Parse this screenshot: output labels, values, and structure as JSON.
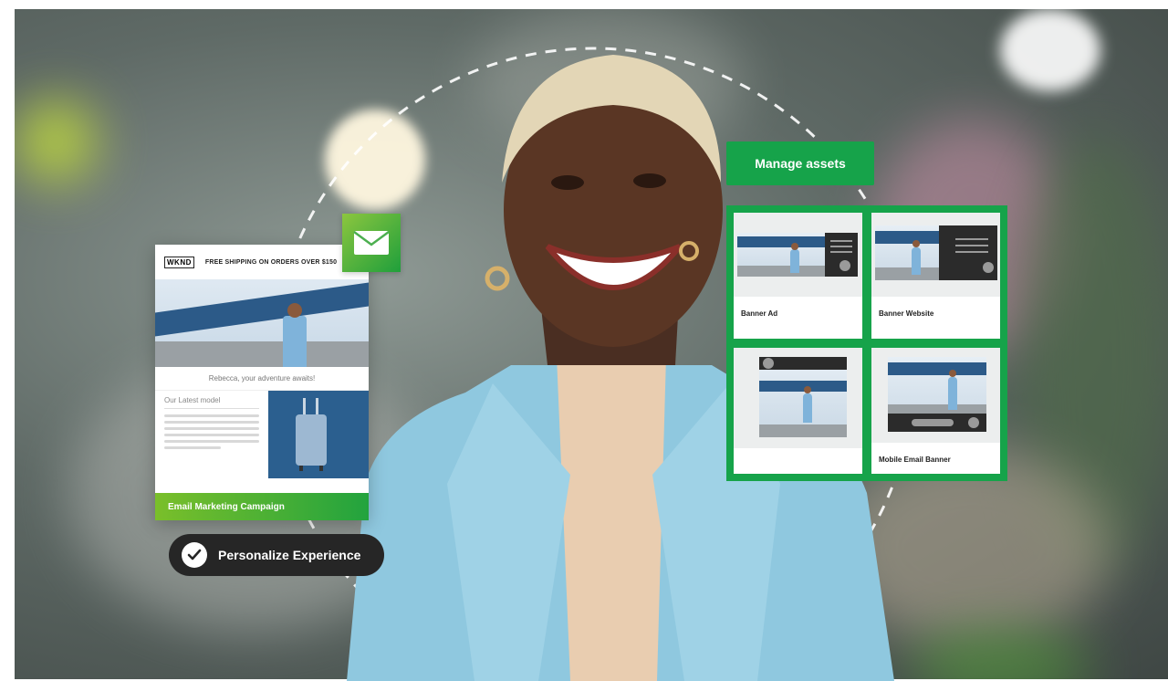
{
  "email_card": {
    "logo": "WKND",
    "shipping_banner": "FREE SHIPPING ON ORDERS OVER $150",
    "greeting": "Rebecca, your adventure awaits!",
    "section_title": "Our Latest model",
    "footer_label": "Email Marketing Campaign"
  },
  "personalize_pill": {
    "label": "Personalize Experience"
  },
  "manage_assets": {
    "button_label": "Manage assets",
    "tiles": [
      {
        "caption": "Banner Ad"
      },
      {
        "caption": "Banner Website"
      },
      {
        "caption": ""
      },
      {
        "caption": "Mobile Email Banner"
      }
    ]
  },
  "colors": {
    "brand_green": "#16a34a",
    "gradient_start": "#7abf2a",
    "pill_bg": "#262626",
    "jacket": "#8fc8df"
  },
  "icons": [
    "envelope-icon",
    "checkmark-icon"
  ]
}
